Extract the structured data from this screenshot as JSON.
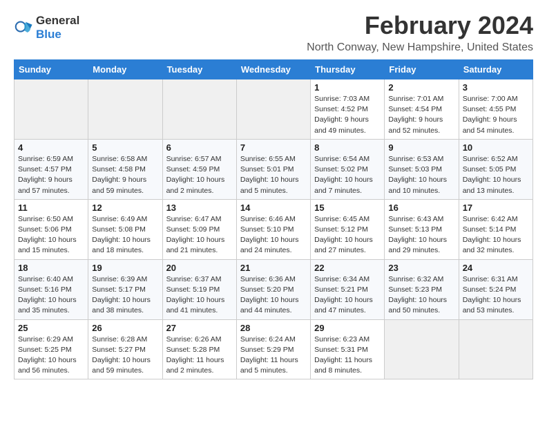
{
  "logo": {
    "line1": "General",
    "line2": "Blue"
  },
  "title": "February 2024",
  "subtitle": "North Conway, New Hampshire, United States",
  "weekdays": [
    "Sunday",
    "Monday",
    "Tuesday",
    "Wednesday",
    "Thursday",
    "Friday",
    "Saturday"
  ],
  "weeks": [
    [
      {
        "day": "",
        "info": ""
      },
      {
        "day": "",
        "info": ""
      },
      {
        "day": "",
        "info": ""
      },
      {
        "day": "",
        "info": ""
      },
      {
        "day": "1",
        "info": "Sunrise: 7:03 AM\nSunset: 4:52 PM\nDaylight: 9 hours\nand 49 minutes."
      },
      {
        "day": "2",
        "info": "Sunrise: 7:01 AM\nSunset: 4:54 PM\nDaylight: 9 hours\nand 52 minutes."
      },
      {
        "day": "3",
        "info": "Sunrise: 7:00 AM\nSunset: 4:55 PM\nDaylight: 9 hours\nand 54 minutes."
      }
    ],
    [
      {
        "day": "4",
        "info": "Sunrise: 6:59 AM\nSunset: 4:57 PM\nDaylight: 9 hours\nand 57 minutes."
      },
      {
        "day": "5",
        "info": "Sunrise: 6:58 AM\nSunset: 4:58 PM\nDaylight: 9 hours\nand 59 minutes."
      },
      {
        "day": "6",
        "info": "Sunrise: 6:57 AM\nSunset: 4:59 PM\nDaylight: 10 hours\nand 2 minutes."
      },
      {
        "day": "7",
        "info": "Sunrise: 6:55 AM\nSunset: 5:01 PM\nDaylight: 10 hours\nand 5 minutes."
      },
      {
        "day": "8",
        "info": "Sunrise: 6:54 AM\nSunset: 5:02 PM\nDaylight: 10 hours\nand 7 minutes."
      },
      {
        "day": "9",
        "info": "Sunrise: 6:53 AM\nSunset: 5:03 PM\nDaylight: 10 hours\nand 10 minutes."
      },
      {
        "day": "10",
        "info": "Sunrise: 6:52 AM\nSunset: 5:05 PM\nDaylight: 10 hours\nand 13 minutes."
      }
    ],
    [
      {
        "day": "11",
        "info": "Sunrise: 6:50 AM\nSunset: 5:06 PM\nDaylight: 10 hours\nand 15 minutes."
      },
      {
        "day": "12",
        "info": "Sunrise: 6:49 AM\nSunset: 5:08 PM\nDaylight: 10 hours\nand 18 minutes."
      },
      {
        "day": "13",
        "info": "Sunrise: 6:47 AM\nSunset: 5:09 PM\nDaylight: 10 hours\nand 21 minutes."
      },
      {
        "day": "14",
        "info": "Sunrise: 6:46 AM\nSunset: 5:10 PM\nDaylight: 10 hours\nand 24 minutes."
      },
      {
        "day": "15",
        "info": "Sunrise: 6:45 AM\nSunset: 5:12 PM\nDaylight: 10 hours\nand 27 minutes."
      },
      {
        "day": "16",
        "info": "Sunrise: 6:43 AM\nSunset: 5:13 PM\nDaylight: 10 hours\nand 29 minutes."
      },
      {
        "day": "17",
        "info": "Sunrise: 6:42 AM\nSunset: 5:14 PM\nDaylight: 10 hours\nand 32 minutes."
      }
    ],
    [
      {
        "day": "18",
        "info": "Sunrise: 6:40 AM\nSunset: 5:16 PM\nDaylight: 10 hours\nand 35 minutes."
      },
      {
        "day": "19",
        "info": "Sunrise: 6:39 AM\nSunset: 5:17 PM\nDaylight: 10 hours\nand 38 minutes."
      },
      {
        "day": "20",
        "info": "Sunrise: 6:37 AM\nSunset: 5:19 PM\nDaylight: 10 hours\nand 41 minutes."
      },
      {
        "day": "21",
        "info": "Sunrise: 6:36 AM\nSunset: 5:20 PM\nDaylight: 10 hours\nand 44 minutes."
      },
      {
        "day": "22",
        "info": "Sunrise: 6:34 AM\nSunset: 5:21 PM\nDaylight: 10 hours\nand 47 minutes."
      },
      {
        "day": "23",
        "info": "Sunrise: 6:32 AM\nSunset: 5:23 PM\nDaylight: 10 hours\nand 50 minutes."
      },
      {
        "day": "24",
        "info": "Sunrise: 6:31 AM\nSunset: 5:24 PM\nDaylight: 10 hours\nand 53 minutes."
      }
    ],
    [
      {
        "day": "25",
        "info": "Sunrise: 6:29 AM\nSunset: 5:25 PM\nDaylight: 10 hours\nand 56 minutes."
      },
      {
        "day": "26",
        "info": "Sunrise: 6:28 AM\nSunset: 5:27 PM\nDaylight: 10 hours\nand 59 minutes."
      },
      {
        "day": "27",
        "info": "Sunrise: 6:26 AM\nSunset: 5:28 PM\nDaylight: 11 hours\nand 2 minutes."
      },
      {
        "day": "28",
        "info": "Sunrise: 6:24 AM\nSunset: 5:29 PM\nDaylight: 11 hours\nand 5 minutes."
      },
      {
        "day": "29",
        "info": "Sunrise: 6:23 AM\nSunset: 5:31 PM\nDaylight: 11 hours\nand 8 minutes."
      },
      {
        "day": "",
        "info": ""
      },
      {
        "day": "",
        "info": ""
      }
    ]
  ]
}
